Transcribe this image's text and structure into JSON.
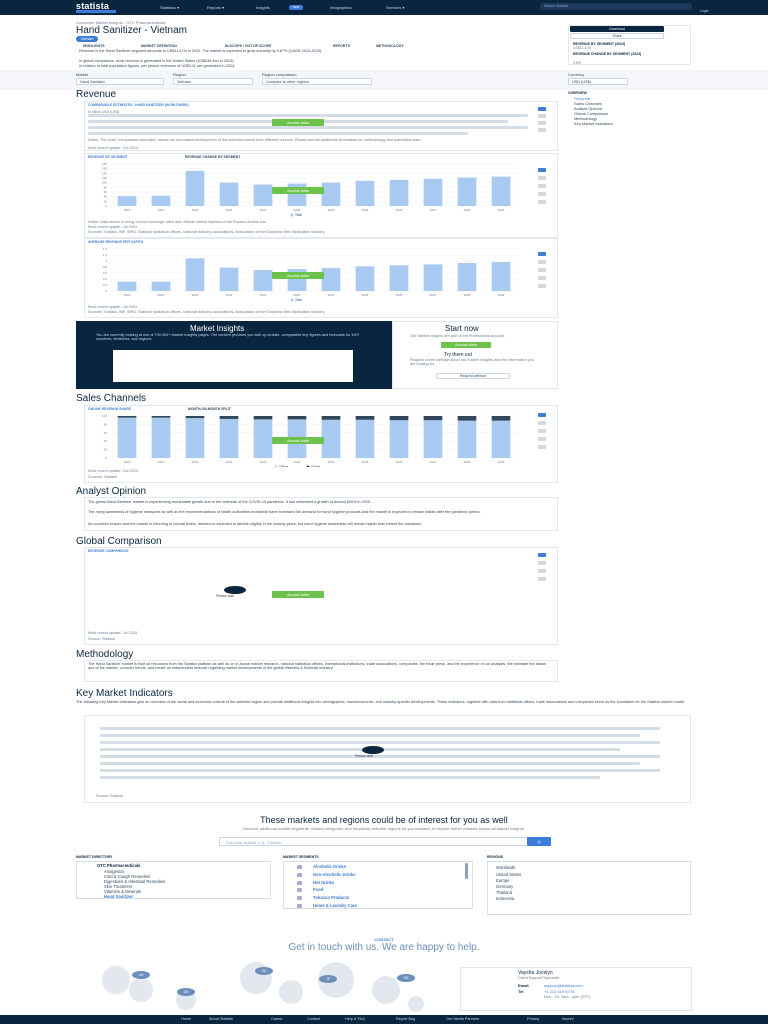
{
  "header": {
    "logo": "statista",
    "logo_sub": "",
    "nav": [
      "Statistics ▾",
      "Reports ▾",
      "Insights",
      "Infographics",
      "Services ▾"
    ],
    "new_badge": "NEW",
    "search_placeholder": "Search Statista",
    "account": "",
    "login": "Login"
  },
  "breadcrumb": "Consumer Market Insights › OTC Pharmaceuticals",
  "title": "Hand Sanitizer - Vietnam",
  "region_badge": "Vietnam",
  "subtabs": [
    "HIGHLIGHTS",
    "MARKET DEFINITION",
    "IN-SCOPE / OUT-OF-SCOPE",
    "REPORTS",
    "METHODOLOGY"
  ],
  "highlights": [
    "Revenue in the Hand Sanitizer segment amounts to US$11.47m in 2024. The market is expected to grow annually by 9.67% (CAGR 2024-2029).",
    "In global comparison, most revenue is generated in the United States (US$638.4bn in 2024).",
    "In relation to total population figures, per person revenues of US$0.11 are generated in 2024."
  ],
  "sidecard": {
    "download": "Download",
    "share": "Share",
    "stat1_label": "REVENUE BY SEGMENT (2024)",
    "stat1_value": "US$11.47m",
    "stat2_label": "REVENUE CHANGE BY SEGMENT (2024)",
    "stat2_value": "9.6%"
  },
  "filters": {
    "market_label": "Market",
    "market_value": "Hand Sanitizer",
    "region_label": "Region",
    "region_value": "Vietnam",
    "comparison_label": "Region comparison",
    "comparison_value": "Compare to other regions",
    "currency_label": "Currency",
    "currency_value": "USD (US$)"
  },
  "overview": {
    "head": "OVERVIEW",
    "items": [
      "Revenue",
      "Sales Channels",
      "Analyst Opinion",
      "Global Comparison",
      "Methodology",
      "Key Market Indicators"
    ]
  },
  "revenue": {
    "section_title": "Revenue",
    "panel1_head": "COMPARABLE ESTIMATES - HAND SANITIZER (WORLDWIDE)",
    "panel1_legend": "In billion USD (US$)",
    "panel1_notes": "Notes: The chart \"comparable estimates\" shows the forecasted development of the selected market from different sources. Please see the additional information for methodology and publication date.",
    "panel1_updated": "Most recent update: Oct 2024",
    "panel2_head_a": "REVENUE BY SEGMENT",
    "panel2_head_b": "REVENUE CHANGE BY SEGMENT",
    "panel2_notes": "Notes: Data shown is using current exchange rates and reflects market impacts of the Russia-Ukraine war.",
    "panel2_updated": "Most recent update: Jul 2024",
    "panel2_sources": "Sources: Statista, IMF, WHO, National statistical offices, National industry associations, Association of the European Self-Medication Industry",
    "panel3_head": "AVERAGE REVENUE PER CAPITA",
    "panel3_updated": "Most recent update: Jul 2024",
    "panel3_sources": "Sources: Statista, IMF, WHO, National statistical offices, National industry associations, Association of the European Self-Medication Industry",
    "access_label": "Access data"
  },
  "chart_data": [
    {
      "type": "bar",
      "title": "",
      "categories": [
        "2018",
        "2019",
        "2020",
        "2021",
        "2022",
        "2023",
        "2024",
        "2025",
        "2026",
        "2027",
        "2028",
        "2029"
      ],
      "series": [
        {
          "name": "Total",
          "values": [
            2.1,
            2.2,
            7.5,
            5.0,
            4.6,
            4.8,
            5.0,
            5.4,
            5.6,
            5.8,
            6.1,
            6.3
          ]
        }
      ],
      "ylabel": "",
      "yticks": [
        "0",
        "20",
        "40",
        "60",
        "80",
        "100",
        "120",
        "140",
        "160",
        "180"
      ],
      "ylim": [
        0,
        9
      ]
    },
    {
      "type": "bar",
      "title": "",
      "categories": [
        "2018",
        "2019",
        "2020",
        "2021",
        "2022",
        "2023",
        "2024",
        "2025",
        "2026",
        "2027",
        "2028",
        "2029"
      ],
      "series": [
        {
          "name": "Total",
          "values": [
            0.2,
            0.2,
            0.7,
            0.5,
            0.45,
            0.47,
            0.49,
            0.53,
            0.55,
            0.57,
            0.6,
            0.62
          ]
        }
      ],
      "ylabel": "",
      "yticks": [
        "0",
        "0.2",
        "0.4",
        "0.6",
        "0.8",
        "1",
        "1.2",
        "1.4"
      ],
      "ylim": [
        0,
        0.9
      ]
    },
    {
      "type": "bar",
      "title": "",
      "categories": [
        "2018",
        "2019",
        "2020",
        "2021",
        "2022",
        "2023",
        "2024",
        "2025",
        "2026",
        "2027",
        "2028",
        "2029"
      ],
      "series": [
        {
          "name": "Offline",
          "values": [
            96,
            96,
            95,
            93,
            92,
            92,
            91,
            91,
            90,
            90,
            89,
            89
          ]
        },
        {
          "name": "Online",
          "values": [
            4,
            4,
            5,
            7,
            8,
            8,
            9,
            9,
            10,
            10,
            11,
            11
          ]
        }
      ],
      "ylabel": "",
      "yticks": [
        "0",
        "20",
        "40",
        "60",
        "80",
        "100"
      ],
      "ylim": [
        0,
        100
      ]
    }
  ],
  "insights": {
    "title": "Market Insights",
    "text": "You are currently looking at one of 700,000+ Market Insights pages. The content provides you with up-to-date, comparable key figures and forecasts for 190+ countries, territories, and regions.",
    "start_title": "Start now",
    "start_text": "Our Market Insights are part of the Professional Account.",
    "start_btn": "Access data",
    "try_title": "Try them out",
    "try_text": "Request a free webinar about our Market Insights and the information you are looking for.",
    "try_btn": "Request webinar"
  },
  "sales": {
    "section_title": "Sales Channels",
    "head_a": "ONLINE REVENUE SHARE",
    "head_b": "MONTH-ON-MONTH SPLIT",
    "legend": [
      "Offline",
      "Online"
    ],
    "updated": "Most recent update: Oct 2024",
    "sources": "Sources: Statista"
  },
  "analyst": {
    "section_title": "Analyst Opinion",
    "p1": "The global Hand Sanitizer market is experiencing remarkable growth due to the outbreak of the COVID-19 pandemic. It has witnessed a growth of around 600% in 2020.",
    "p2": "The rising awareness of hygiene measures as well as the recommendations of health authorities worldwide have increased the demand for hand hygiene products and the market is expected to remain stable after the pandemic period.",
    "p3": "As countries reopen and the market is returning to normal levels, demand is expected to decline slightly in the coming years, but hand hygiene awareness will remain higher than before the pandemic."
  },
  "global": {
    "section_title": "Global Comparison",
    "head": "REVENUE COMPARISON",
    "please_wait": "Please wait",
    "updated": "Most recent update: Jul 2024",
    "sources": "Source: Statista"
  },
  "methodology": {
    "section_title": "Methodology",
    "text": "The Hand Sanitizer market is built on resources from the Statista platform as well as on in-house market research, national statistical offices, international institutions, trade associations, companies, the trade press, and the experience of our analysts. We estimate the status quo of the market, consider trends, and create an independent forecast regarding market developments of the global Vitamins & Minerals industry."
  },
  "kmi": {
    "section_title": "Key Market Indicators",
    "text": "The following Key Market Indicators give an overview of the social and economic outlook of the selected region and provide additional insights into demographic, macroeconomic, and industry-specific developments. These indicators, together with data from statistical offices, trade associations and companies serve as the foundation for the Statista market model.",
    "please_wait": "Please wait",
    "source": "Source: Statista"
  },
  "interest": {
    "title": "These markets and regions could be of interest for you as well",
    "subtitle": "Discover additional market segments, related categories, and frequently selected regions for you research or explore further markets across all Market Insights.",
    "search_placeholder": "Find your market, e.g., Fashion",
    "search_btn": "Q"
  },
  "directory": {
    "head": "MARKET DIRECTORY",
    "parent": "OTC Pharmaceuticals",
    "items": [
      "Analgesics",
      "Cold & Cough Remedies",
      "Digestives & Intestinal Remedies",
      "Skin Treatment",
      "Vitamins & Minerals",
      "Hand Sanitizer"
    ],
    "segments_head": "MARKET SEGMENTS",
    "segments": [
      "Alcoholic Drinks",
      "Non-Alcoholic Drinks",
      "Hot Drinks",
      "Food",
      "Tobacco Products",
      "Home & Laundry Care"
    ],
    "regions_head": "REGIONS",
    "regions": [
      "Worldwide",
      "United States",
      "Europe",
      "Germany",
      "Thailand",
      "Indonesia"
    ]
  },
  "contact": {
    "label": "CONTACT",
    "title": "Get in touch with us. We are happy to help.",
    "name": "Vaysha Jocelyn",
    "role": "Client Support Specialist",
    "email_label": "Email",
    "email": "support@statista.com",
    "tel_label": "Tel",
    "tel": "+1 212 419 5774",
    "hours": "Mon - Fri, 9am - 6pm (EST)",
    "map_pins": [
      "US",
      "DE",
      "UK",
      "JP",
      "SG"
    ]
  },
  "footer": [
    "Home",
    "About Statista",
    "Career",
    "Contact",
    "Help & FAQ",
    "Report Bug",
    "Our Media Partners",
    "Privacy",
    "Imprint"
  ],
  "colors": {
    "brand": "#0a2540",
    "accent": "#3b7dd8",
    "green": "#6cc24a",
    "bar": "#a8c9f0"
  }
}
